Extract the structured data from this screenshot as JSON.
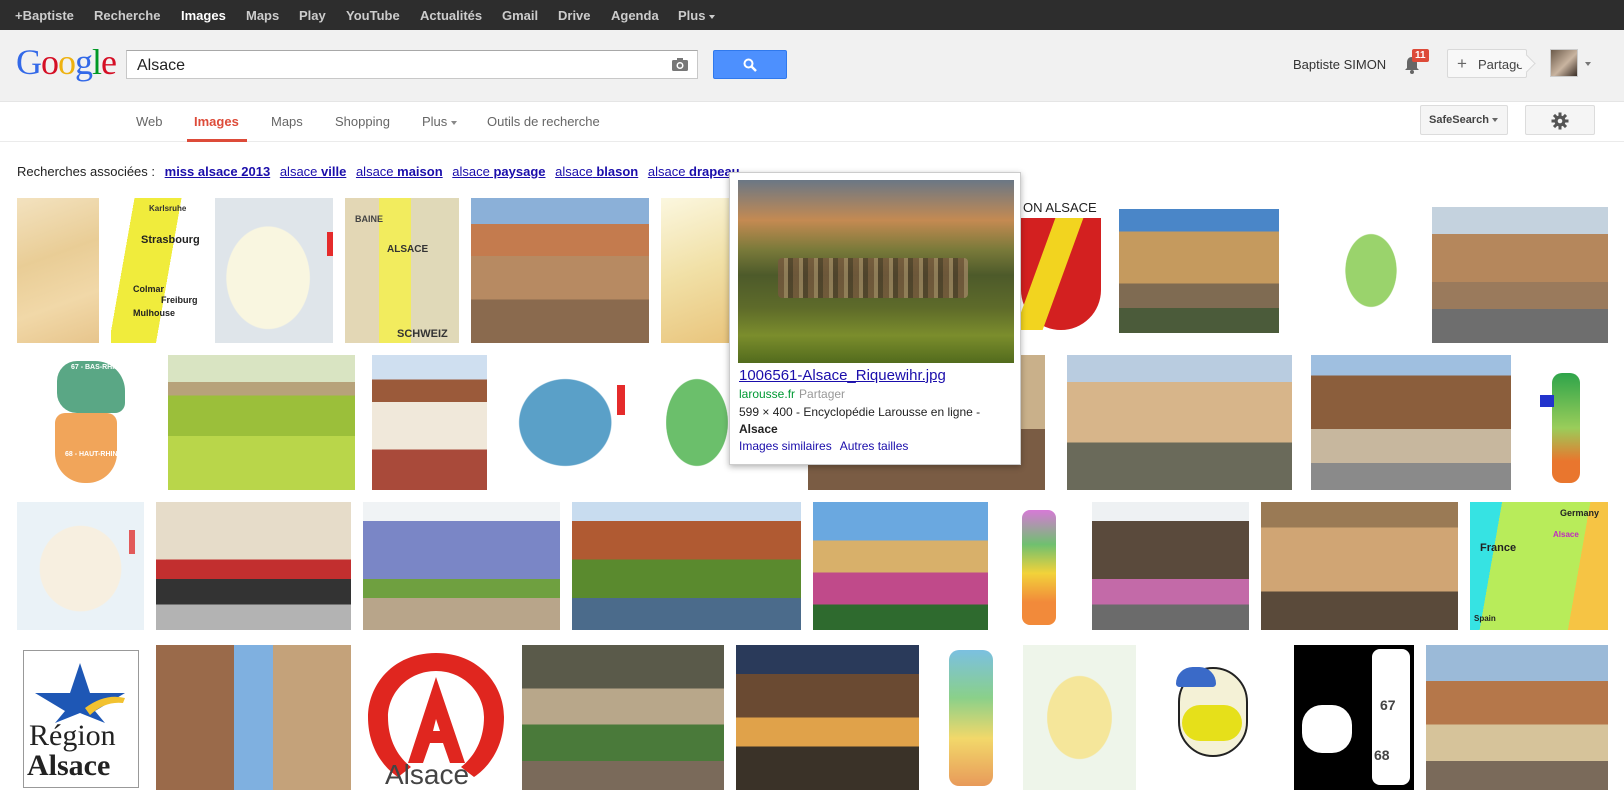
{
  "topbar": {
    "items": [
      "+Baptiste",
      "Recherche",
      "Images",
      "Maps",
      "Play",
      "YouTube",
      "Actualités",
      "Gmail",
      "Drive",
      "Agenda",
      "Plus"
    ]
  },
  "header": {
    "logo": {
      "G": "G",
      "o1": "o",
      "o2": "o",
      "g": "g",
      "l": "l",
      "e": "e"
    },
    "search_value": "Alsace",
    "username": "Baptiste SIMON",
    "notification_count": "11",
    "share_label": "Partager"
  },
  "tabs": {
    "items": [
      "Web",
      "Images",
      "Maps",
      "Shopping",
      "Plus",
      "Outils de recherche"
    ],
    "active": "Images",
    "safesearch_label": "SafeSearch"
  },
  "related": {
    "prefix": "Recherches associées :",
    "items": [
      {
        "base": "miss alsace",
        "bold": " 2013"
      },
      {
        "base": "alsace",
        "bold": " ville"
      },
      {
        "base": "alsace",
        "bold": " maison"
      },
      {
        "base": "alsace",
        "bold": " paysage"
      },
      {
        "base": "alsace",
        "bold": " blason"
      },
      {
        "base": "alsace",
        "bold": " drapeau"
      }
    ]
  },
  "thumb_labels": {
    "strasbourg": "Strasbourg",
    "colmar": "Colmar",
    "mulhouse": "Mulhouse",
    "freiburg": "Freiburg",
    "karlsruhe": "Karlsruhe",
    "baine": "BAINE",
    "alsace_map": "ALSACE",
    "schweiz": "SCHWEIZ",
    "bas_rhin_67": "67 - BAS-RHIN",
    "haut_rhin_68": "68 - HAUT-RHIN",
    "on_alsace": "ON ALSACE",
    "france": "France",
    "germany": "Germany",
    "spain": "Spain",
    "alsace_small": "Alsace",
    "region": "Région",
    "region_alsace": "Alsace",
    "logo_alsace": "Alsace",
    "n67": "67",
    "n68": "68"
  },
  "popup": {
    "title": "1006561-Alsace_Riquewihr.jpg",
    "domain": "larousse.fr",
    "share": "Partager",
    "description": "599 × 400 - Encyclopédie Larousse en ligne -",
    "description_bold": "Alsace",
    "link_similar": "Images similaires",
    "link_sizes": "Autres tailles"
  },
  "colors": {
    "topbar_bg": "#2d2d2d",
    "accent_red": "#dd4b39",
    "link_blue": "#1a0dab",
    "search_blue": "#4d90fe",
    "domain_green": "#009933"
  }
}
